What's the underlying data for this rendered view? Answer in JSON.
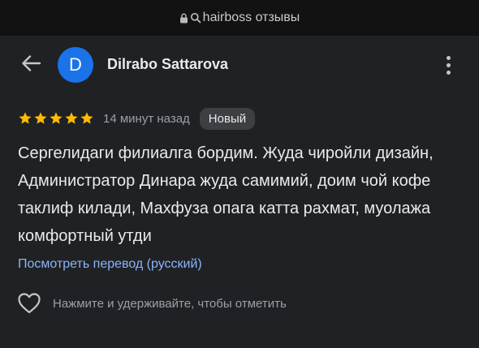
{
  "browser": {
    "url_text": "hairboss отзывы"
  },
  "review": {
    "avatar_letter": "D",
    "avatar_color": "#1a73e8",
    "author": "Dilrabo Sattarova",
    "rating": 5,
    "time_ago": "14 минут назад",
    "badge": "Новый",
    "text": "Сергелидаги филиалга бордим. Жуда чиройли дизайн, Администратор Динара жуда самимий, доим чой кофе таклиф килади, Махфуза опага катта рахмат, муолажа комфортный утди",
    "translate_link": "Посмотреть перевод (русский)",
    "like_hint": "Нажмите и удерживайте, чтобы отметить"
  },
  "colors": {
    "star": "#fbbc04",
    "link": "#8ab4f8",
    "background": "#202124"
  },
  "icons": {
    "url_bar": [
      "lock-icon",
      "search-icon"
    ],
    "header": [
      "back-arrow-icon",
      "more-vert-icon"
    ],
    "footer": [
      "heart-outline-icon"
    ]
  }
}
